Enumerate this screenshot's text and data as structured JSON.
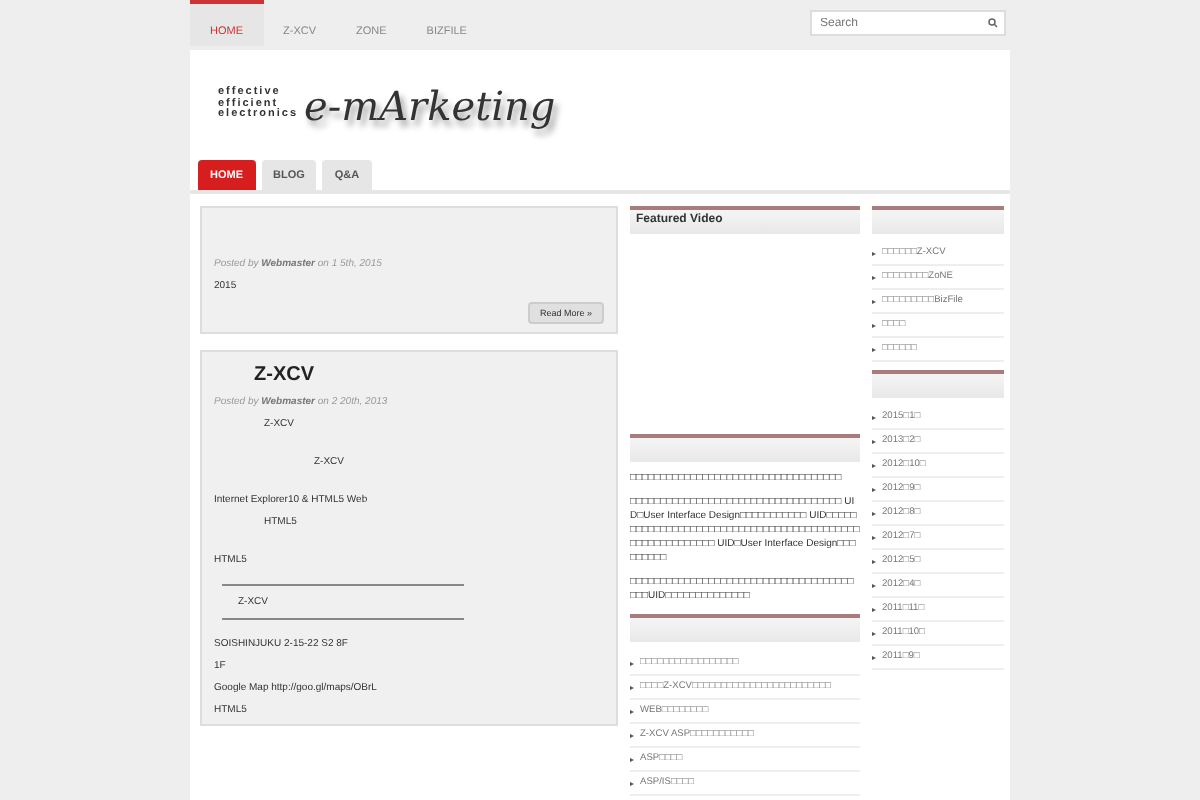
{
  "top_nav": [
    {
      "label": "HOME",
      "selected": true
    },
    {
      "label": "Z-XCV",
      "selected": false
    },
    {
      "label": "ZONE",
      "selected": false
    },
    {
      "label": "BIZFILE",
      "selected": false
    }
  ],
  "search": {
    "placeholder": "Search"
  },
  "logo": {
    "tagline": [
      "effective",
      "efficient",
      "electronics"
    ],
    "wordmark": "e-mArketing"
  },
  "tabs": [
    {
      "label": "HOME",
      "selected": true
    },
    {
      "label": "BLOG",
      "selected": false
    },
    {
      "label": "Q&A",
      "selected": false
    }
  ],
  "posts": [
    {
      "posted_by": "Posted by",
      "author": "Webmaster",
      "date": "on 1   5th, 2015",
      "lines": [
        {
          "text": "2015",
          "kind": "plain"
        }
      ],
      "read_more": "Read More »"
    },
    {
      "title": "Z-XCV",
      "posted_by": "Posted by",
      "author": "Webmaster",
      "date": "on 2   20th, 2013",
      "lines": [
        {
          "text": "Z-XCV",
          "kind": "indent"
        },
        {
          "text": "Z-XCV",
          "kind": "deep"
        },
        {
          "text": "Internet Explorer10 & HTML5 Web",
          "kind": "spaced"
        },
        {
          "text": "HTML5",
          "kind": "indent"
        },
        {
          "text": "HTML5",
          "kind": "spaced"
        }
      ],
      "boxed": "Z-XCV",
      "footer_lines": [
        "SOISHINJUKU      2-15-22 S2    8F",
        "1F",
        "Google Map      http://goo.gl/maps/OBrL",
        "HTML5"
      ]
    }
  ],
  "middle": {
    "featured_title": "Featured Video",
    "paragraphs": [
      "□□□□□□□□□□□□□□□□□□□□□□□□□□□□□□□□□□□",
      "□□□□□□□□□□□□□□□□□□□□□□□□□□□□□□□□□□□ UID□User Interface Design□□□□□□□□□□□ UID□□□□□□□□□□□□□□□□□□□□□□□□□□□□□□□□□□□□□□□□□□□□□□□□□□□□□□□□□ UID□User Interface Design□□□□□□□□□",
      "□□□□□□□□□□□□□□□□□□□□□□□□□□□□□□□□□□□□□ □□□UID□□□□□□□□□□□□□□"
    ],
    "links": [
      "□□□□□□□□□□□□□□□□□",
      "□□□□Z-XCV□□□□□□□□□□□□□□□□□□□□□□□□",
      "WEB□□□□□□□□",
      "Z-XCV ASP□□□□□□□□□□□",
      "ASP□□□□",
      "ASP/IS□□□□"
    ]
  },
  "right": {
    "links": [
      "□□□□□□Z-XCV",
      "□□□□□□□□ZoNE",
      "□□□□□□□□□BizFile",
      "□□□□",
      "□□□□□□"
    ],
    "archives": [
      "2015□1□",
      "2013□2□",
      "2012□10□",
      "2012□9□",
      "2012□8□",
      "2012□7□",
      "2012□5□",
      "2012□4□",
      "2011□11□",
      "2011□10□",
      "2011□9□"
    ]
  }
}
